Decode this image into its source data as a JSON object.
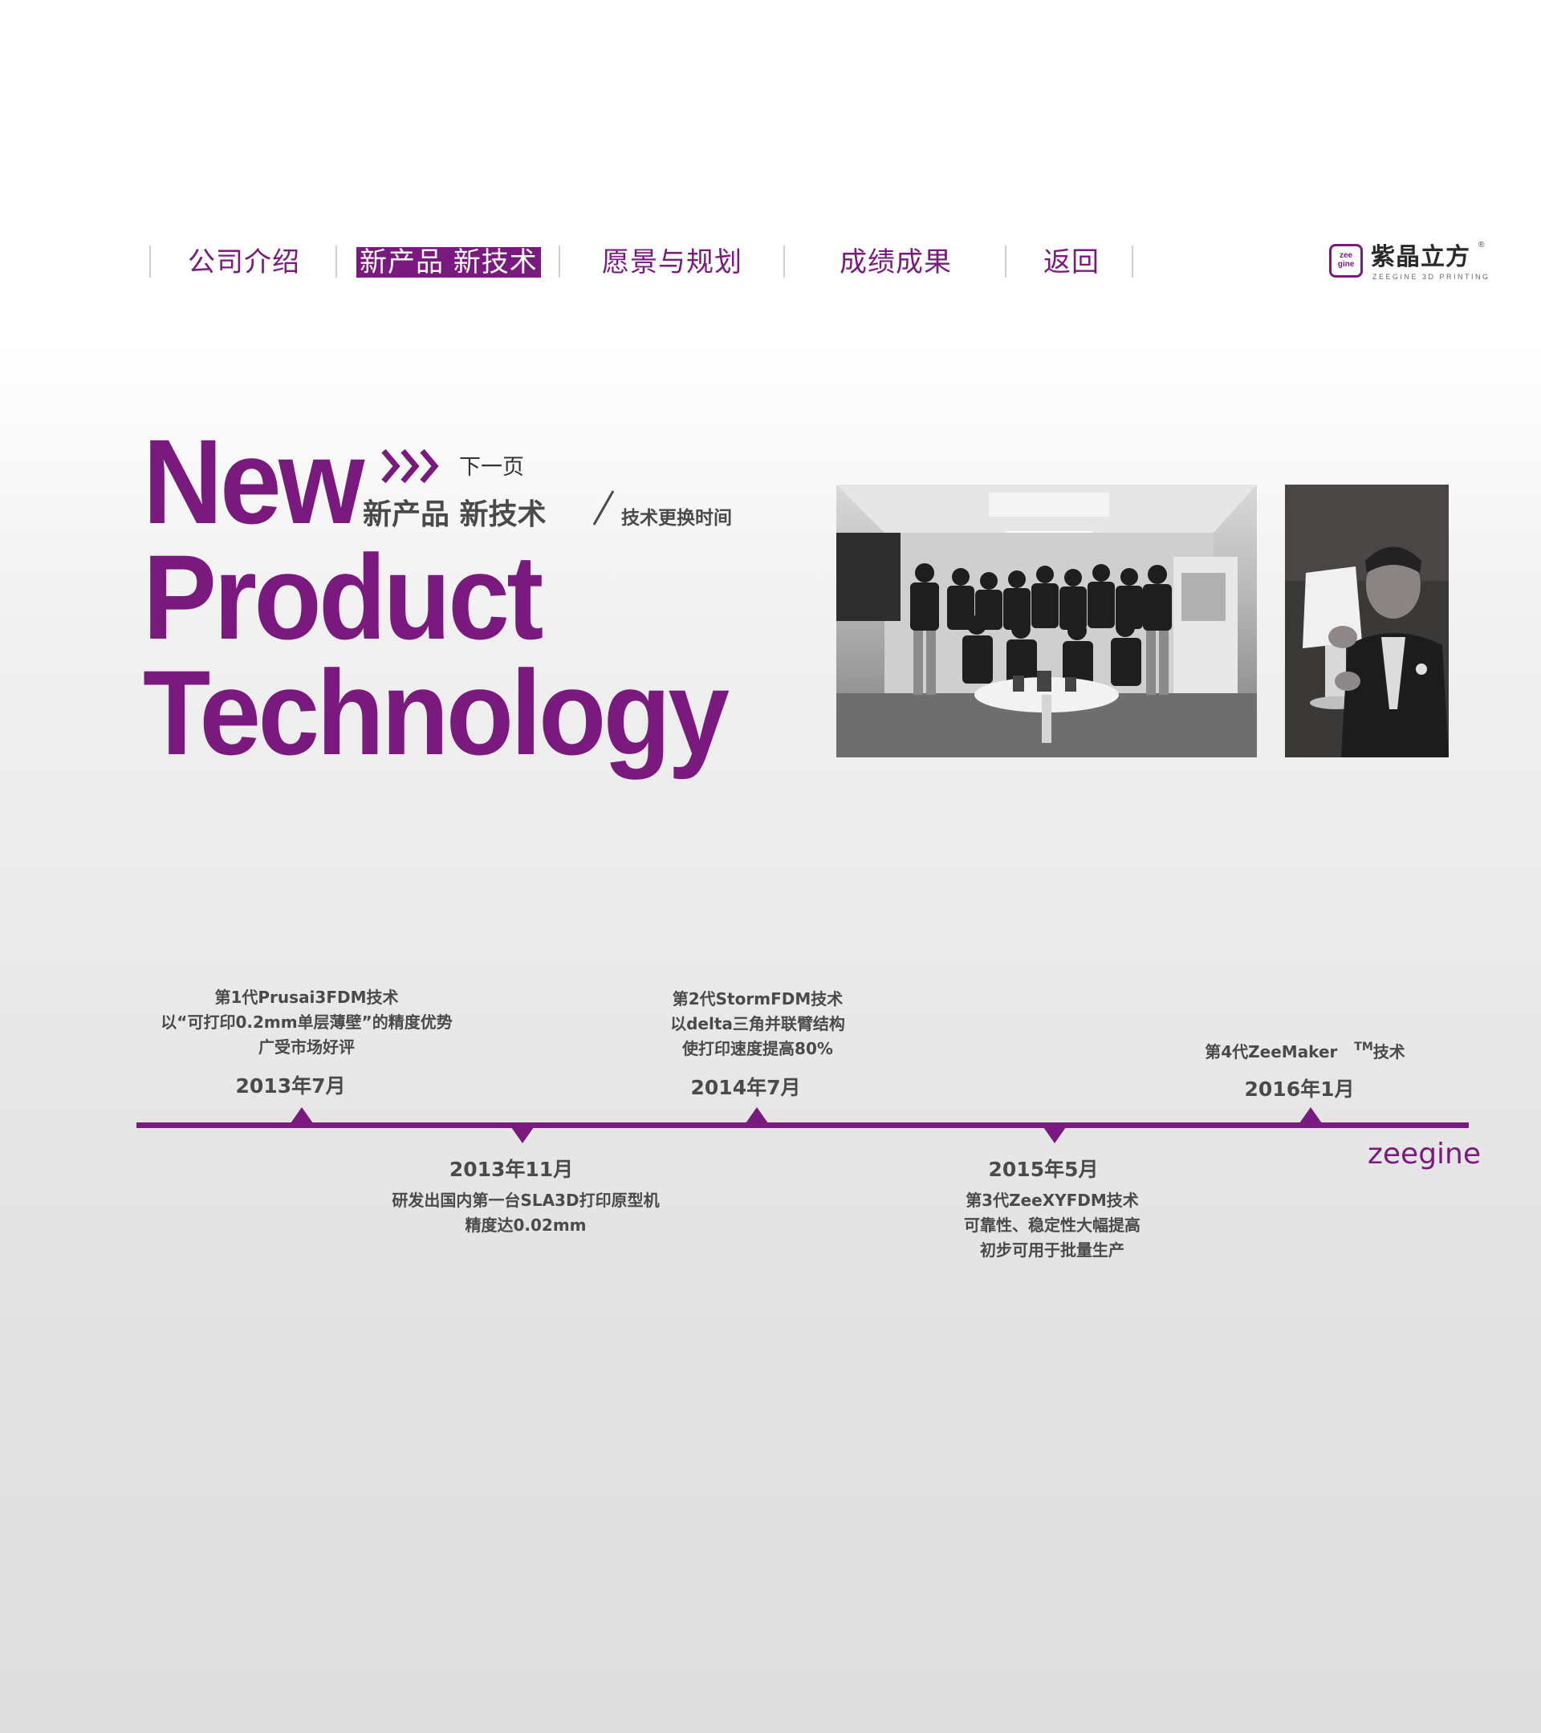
{
  "nav": {
    "items": [
      {
        "label": "公司介绍",
        "active": false
      },
      {
        "label": "新产品 新技术",
        "active": true
      },
      {
        "label": "愿景与规划",
        "active": false
      },
      {
        "label": "成绩成果",
        "active": false
      },
      {
        "label": "返回",
        "active": false
      }
    ],
    "logo": {
      "mark": "zee gine",
      "name_cn": "紫晶立方",
      "registered": "®",
      "name_en": "ZEEGINE 3D PRINTING"
    }
  },
  "hero": {
    "title_lines": [
      "New",
      "Product",
      "Technology"
    ],
    "next_label": "下一页",
    "subtitle": "新产品 新技术",
    "subnote": "技术更换时间"
  },
  "photos": [
    {
      "name": "team-photo",
      "icon": "team-group-photo"
    },
    {
      "name": "speaker-photo",
      "icon": "speaker-holding-lamp-photo"
    }
  ],
  "timeline": {
    "accent": "#7a1a7e",
    "events": [
      {
        "date": "2013年7月",
        "position": "above",
        "lines": [
          "第1代Prusai3FDM技术",
          "以“可打印0.2mm单层薄壁”的精度优势",
          "广受市场好评"
        ]
      },
      {
        "date": "2013年11月",
        "position": "below",
        "lines": [
          "研发出国内第一台SLA3D打印原型机",
          "精度达0.02mm"
        ]
      },
      {
        "date": "2014年7月",
        "position": "above",
        "lines": [
          "第2代StormFDM技术",
          "以delta三角并联臂结构",
          "使打印速度提高80%"
        ]
      },
      {
        "date": "2015年5月",
        "position": "below",
        "lines": [
          "第3代ZeeXYFDM技术",
          "可靠性、稳定性大幅提高",
          "初步可用于批量生产"
        ]
      },
      {
        "date": "2016年1月",
        "position": "above",
        "lines_prefix": "第4代ZeeMaker",
        "lines_tm": "TM",
        "lines_suffix": "技术"
      }
    ],
    "brand": "zeegine"
  }
}
